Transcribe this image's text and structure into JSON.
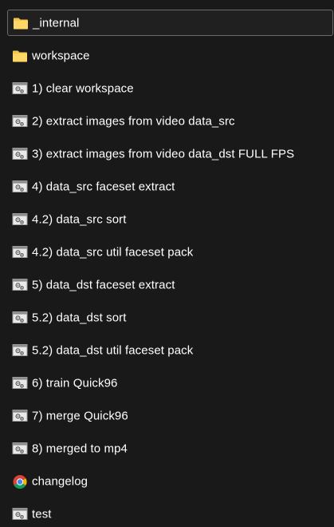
{
  "files": [
    {
      "name": "_internal",
      "icon": "folder-icon",
      "selected": true
    },
    {
      "name": "workspace",
      "icon": "folder-icon",
      "selected": false
    },
    {
      "name": "1) clear workspace",
      "icon": "batch-file-icon",
      "selected": false
    },
    {
      "name": "2) extract images from video data_src",
      "icon": "batch-file-icon",
      "selected": false
    },
    {
      "name": "3) extract images from video data_dst FULL FPS",
      "icon": "batch-file-icon",
      "selected": false
    },
    {
      "name": "4) data_src faceset extract",
      "icon": "batch-file-icon",
      "selected": false
    },
    {
      "name": "4.2) data_src sort",
      "icon": "batch-file-icon",
      "selected": false
    },
    {
      "name": "4.2) data_src util faceset pack",
      "icon": "batch-file-icon",
      "selected": false
    },
    {
      "name": "5) data_dst faceset extract",
      "icon": "batch-file-icon",
      "selected": false
    },
    {
      "name": "5.2) data_dst sort",
      "icon": "batch-file-icon",
      "selected": false
    },
    {
      "name": "5.2) data_dst util faceset pack",
      "icon": "batch-file-icon",
      "selected": false
    },
    {
      "name": "6) train Quick96",
      "icon": "batch-file-icon",
      "selected": false
    },
    {
      "name": "7) merge Quick96",
      "icon": "batch-file-icon",
      "selected": false
    },
    {
      "name": "8) merged to mp4",
      "icon": "batch-file-icon",
      "selected": false
    },
    {
      "name": "changelog",
      "icon": "chrome-icon",
      "selected": false
    },
    {
      "name": "test",
      "icon": "batch-file-icon",
      "selected": false
    }
  ],
  "colors": {
    "background": "#191919",
    "text": "#ffffff",
    "selection_border": "#6b6b6b",
    "folder": "#f5c44b"
  }
}
